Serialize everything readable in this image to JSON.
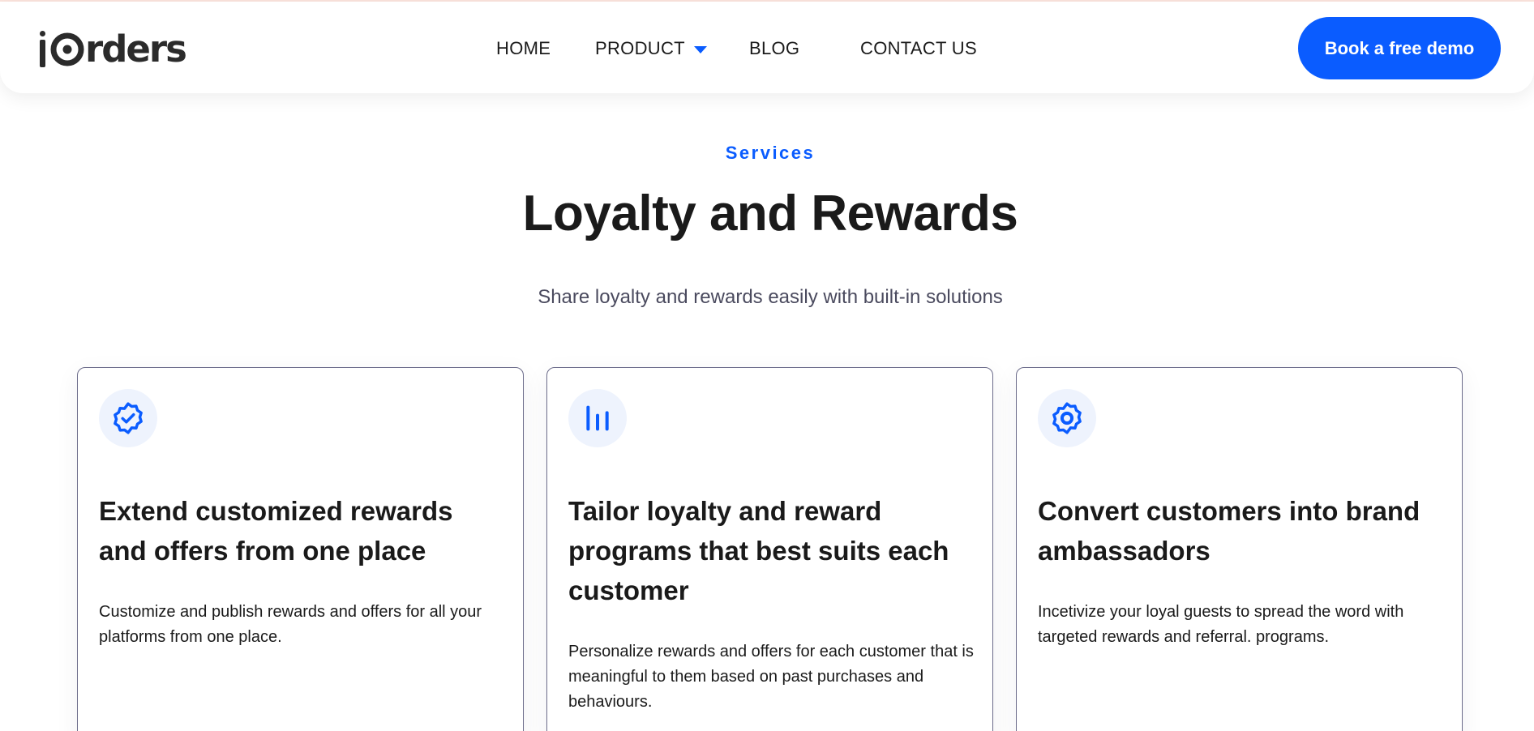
{
  "brand": {
    "name": "iOrders",
    "logo_rest": "rders",
    "accent_color": "#0a5cff"
  },
  "nav": {
    "items": [
      {
        "label": "HOME"
      },
      {
        "label": "PRODUCT",
        "has_dropdown": true
      },
      {
        "label": "BLOG"
      },
      {
        "label": "CONTACT US"
      }
    ],
    "cta_label": "Book a free demo"
  },
  "hero": {
    "eyebrow": "Services",
    "title": "Loyalty and Rewards",
    "subtitle": "Share loyalty and rewards easily with built-in solutions"
  },
  "cards": [
    {
      "icon": "verified-badge-icon",
      "title": "Extend customized rewards and offers from one place",
      "description": "Customize and publish rewards and offers for all your platforms from one place."
    },
    {
      "icon": "bar-chart-icon",
      "title": "Tailor loyalty and reward programs that best suits each customer",
      "description": "Personalize rewards and offers for each customer that is meaningful to them based on past purchases and behaviours."
    },
    {
      "icon": "gear-icon",
      "title": "Convert customers into brand ambassadors",
      "description": "Incetivize your loyal guests to spread the word with targeted rewards and referral. programs."
    }
  ]
}
